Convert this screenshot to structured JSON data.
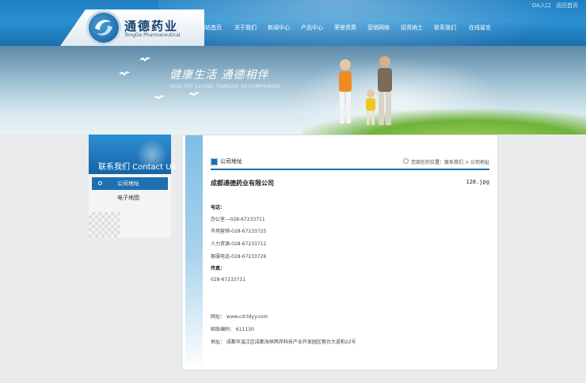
{
  "top_links": [
    "OA入口",
    "返回首页"
  ],
  "logo": {
    "cn": "通德药业",
    "en": "TongDe Pharmaceutical"
  },
  "nav": [
    "网站首页",
    "关于我们",
    "新闻中心",
    "产品中心",
    "荣誉资质",
    "营销网络",
    "招贤纳士",
    "联系我们",
    "在线留言"
  ],
  "banner": {
    "slogan_cn": "健康生活  通德相伴",
    "slogan_en": "HEALTHY LIVING  TONGDE ACCOMPANIED"
  },
  "sidebar": {
    "title": "联系我们  Contact Us",
    "items": [
      {
        "label": "公司地址",
        "active": true
      },
      {
        "label": "电子地图",
        "active": false
      }
    ]
  },
  "content": {
    "section_title": "公司地址",
    "breadcrumb": "您现在的位置：联系我们 > 公司地址",
    "company": "成都通德药业有限公司",
    "image_name": "128.jpg",
    "phone_label": "电话：",
    "phones": [
      "办公室---028-67233711",
      "市场营销-028-67233725",
      "人力资源-028-67233712",
      "客服电话-028-67233726"
    ],
    "fax_label": "传真：",
    "fax": "028-67233711",
    "website": "网址：  www.cd-tdyy.com",
    "postcode": "邮政编码：  611130",
    "address": "地址：  成都市温江区成都海峡两岸科技产业开发园区蓉台大道柏22号"
  },
  "colors": {
    "accent": "#1d6fb0",
    "header": "#2b90d2",
    "page_bg": "#e9ebed"
  }
}
